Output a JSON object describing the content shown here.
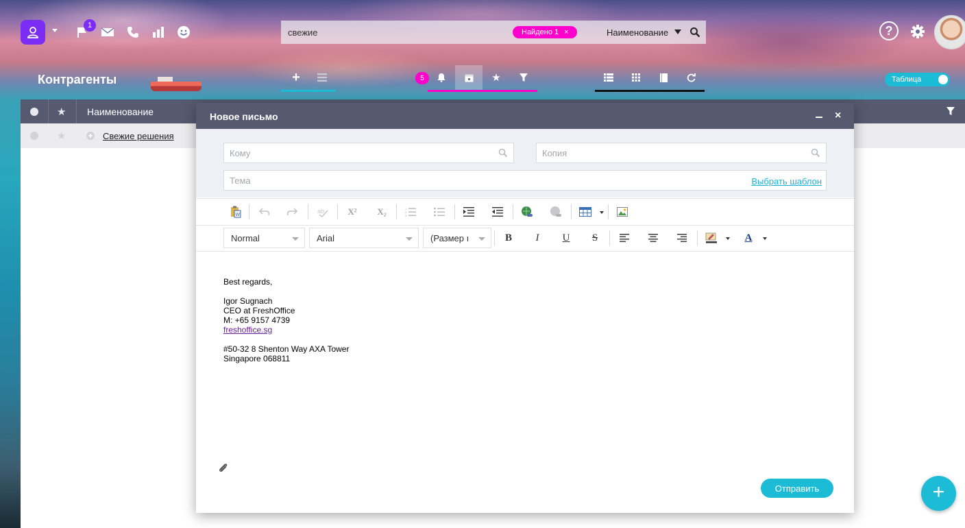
{
  "topbar": {
    "notification_count": "1",
    "search": {
      "value": "свежие",
      "found_label": "Найдено 1",
      "found_close": "×",
      "field_select": "Наименование"
    },
    "help_label": "?"
  },
  "section": {
    "title": "Контрагенты",
    "badge_count": "5",
    "view_toggle_label": "Таблица"
  },
  "table": {
    "columns": [
      "Наименование"
    ],
    "rows": [
      {
        "name": "Свежие решения"
      }
    ]
  },
  "dialog": {
    "title": "Новое письмо",
    "close_label": "×",
    "to_placeholder": "Кому",
    "cc_placeholder": "Копия",
    "subject_placeholder": "Тема",
    "template_link": "Выбрать шаблон",
    "format_dropdown": "Normal",
    "font_dropdown": "Arial",
    "size_dropdown": "(Размер ı",
    "bold": "B",
    "italic": "I",
    "underline": "U",
    "strike": "S",
    "superscript": "X²",
    "subscript": "X₂",
    "text_color": "A",
    "body": {
      "greeting": "Best regards,",
      "name": "Igor Sugnach",
      "role": "CEO at FreshOffice",
      "phone": "M: +65 9157 4739",
      "website": "freshoffice.sg",
      "address1": "#50-32 8 Shenton Way AXA Tower",
      "address2": "Singapore 068811"
    },
    "send_label": "Отправить"
  },
  "fab_label": "+",
  "colors": {
    "accent_cyan": "#1cbcd6",
    "accent_magenta": "#ff00cc",
    "accent_purple": "#7b2cf5",
    "header_slate": "#565a70"
  }
}
